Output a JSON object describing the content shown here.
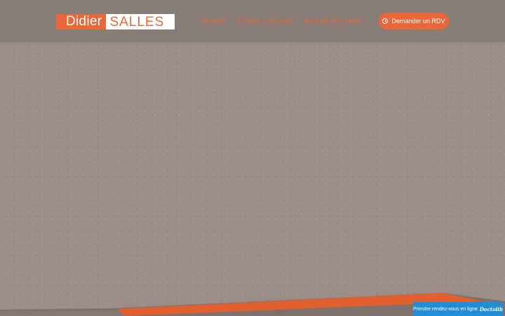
{
  "logo": {
    "first": "Didier",
    "last": "SALLES"
  },
  "nav": {
    "items": [
      {
        "label": "Accueil"
      },
      {
        "label": "Charte d'Accueil"
      },
      {
        "label": "Accueil des lieux"
      }
    ]
  },
  "header": {
    "rdv_button": {
      "label": "Demander un RDV",
      "icon": "clock-icon"
    }
  },
  "doctolib": {
    "label": "Prendre rendez-vous en ligne",
    "brand": "Doctolib"
  },
  "colors": {
    "accent": "#e8683a",
    "background": "#9a8e87",
    "header": "#7a6e67",
    "doctolib": "#1f8ed6"
  }
}
